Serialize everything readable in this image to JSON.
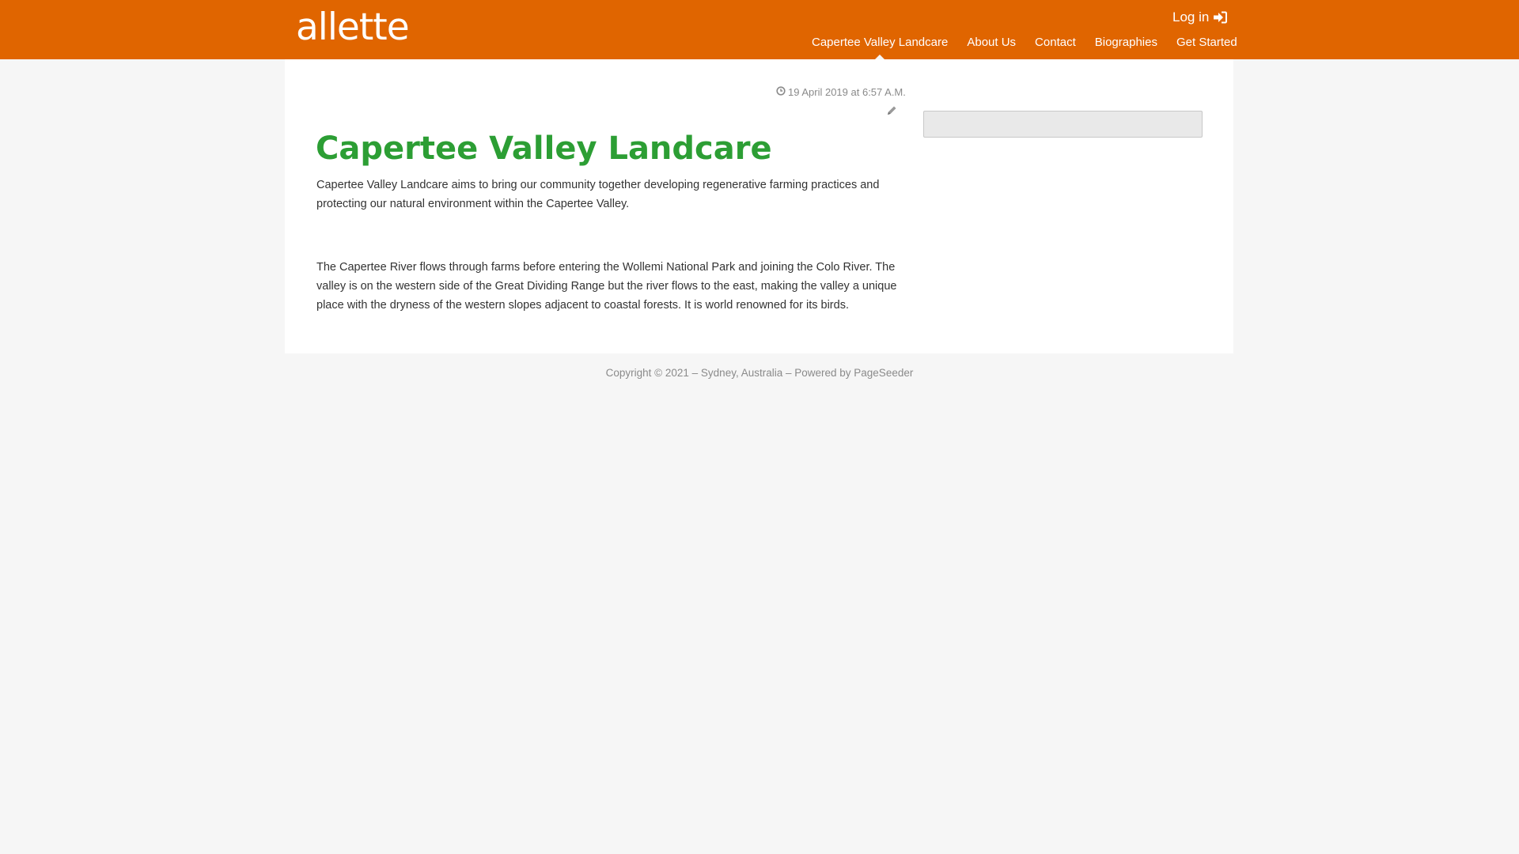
{
  "header": {
    "logo_text": "allette",
    "login_label": "Log in",
    "login_icon": "sign-in-icon",
    "background_color": "#e06500"
  },
  "nav": {
    "items": [
      {
        "label": "Capertee Valley Landcare",
        "active": true
      },
      {
        "label": "About Us",
        "active": false
      },
      {
        "label": "Contact",
        "active": false
      },
      {
        "label": "Biographies",
        "active": false
      },
      {
        "label": "Get Started",
        "active": false
      }
    ]
  },
  "article": {
    "date": "19 April 2019 at 6:57 A.M.",
    "date_icon": "clock-icon",
    "edit_icon": "pencil-icon",
    "title": "Capertee Valley Landcare",
    "title_color": "#2c9e34",
    "paragraphs": [
      "Capertee Valley Landcare aims to bring our community together developing regenerative farming practices and protecting our natural environment within the Capertee Valley.",
      "The Capertee River flows through farms  before entering the Wollemi National Park and joining the Colo River.  The valley is on the western side of the Great Dividing Range but the river flows to the east, making the valley a unique place with the dryness of the western slopes adjacent to coastal forests. It is world renowned for its birds."
    ]
  },
  "sidebar": {
    "search_value": "",
    "search_placeholder": ""
  },
  "footer": {
    "text": "Copyright © 2021 – Sydney, Australia – Powered by PageSeeder"
  }
}
